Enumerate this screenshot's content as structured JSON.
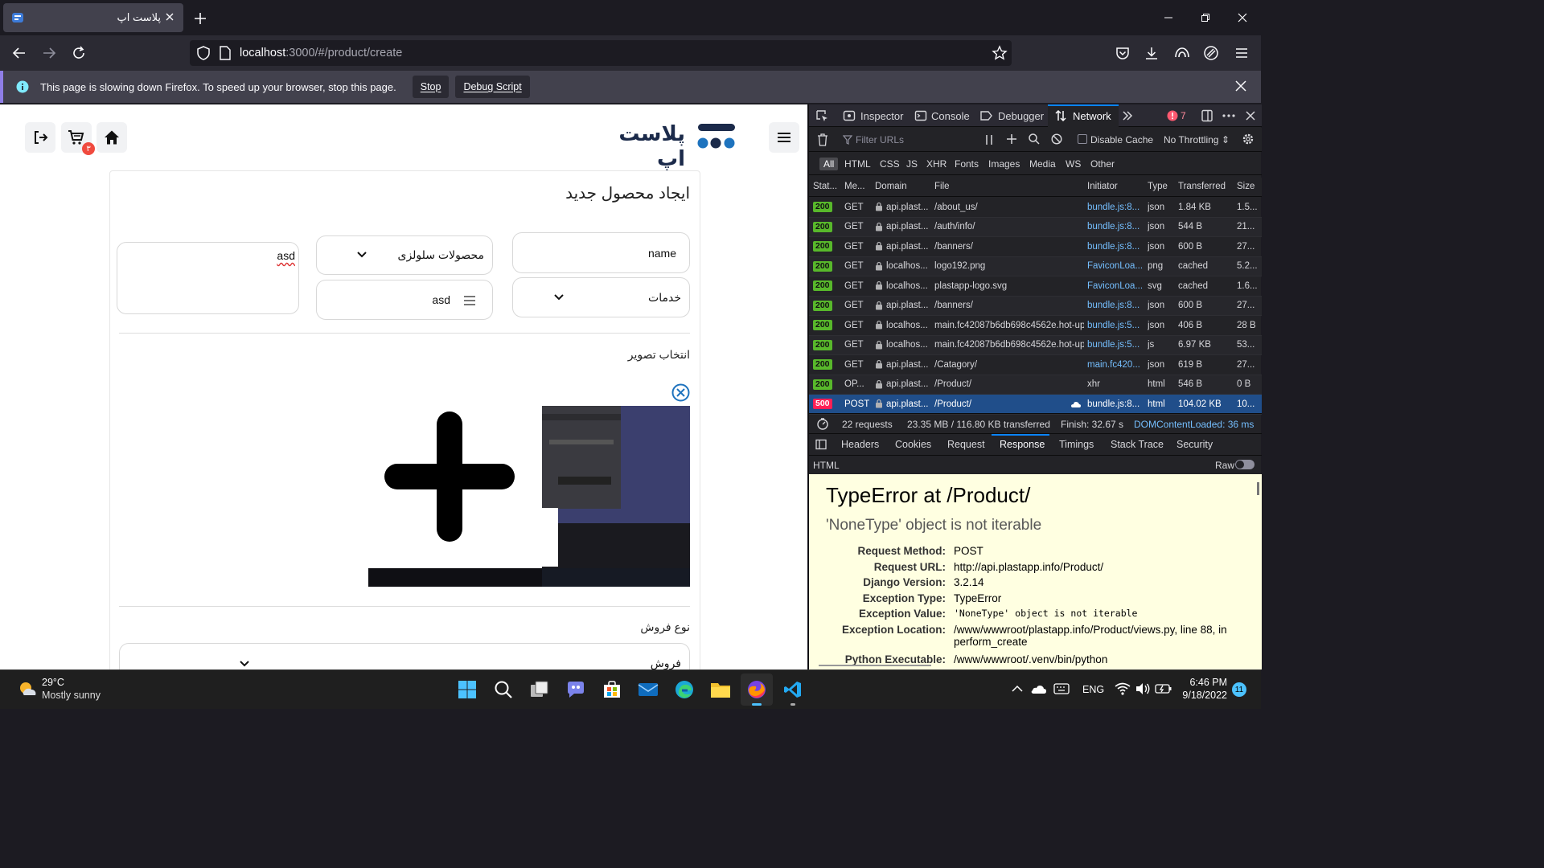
{
  "browser": {
    "tab_title": "پلاست اپ",
    "url_host": "localhost",
    "url_path": ":3000/#/product/create",
    "notification": {
      "message": "This page is slowing down Firefox. To speed up your browser, stop this page.",
      "stop_label": "Stop",
      "debug_label": "Debug Script"
    }
  },
  "app": {
    "brand_name": "پلاست اپ",
    "cart_count": "۳",
    "form_title": "ایجاد محصول جدید",
    "name_value": "name",
    "category_value": "محصولات سلولزی",
    "description_value": "asd",
    "service_value": "خدمات",
    "tag_value": "asd",
    "image_label": "انتخاب تصویر",
    "sale_type_label": "نوع فروش",
    "sale_type_value": "فروش"
  },
  "devtools": {
    "tabs": [
      "Inspector",
      "Console",
      "Debugger",
      "Network"
    ],
    "active_tab": "Network",
    "error_count": "7",
    "filter_placeholder": "Filter URLs",
    "disable_cache_label": "Disable Cache",
    "throttling_label": "No Throttling ⇕",
    "type_filters": [
      "All",
      "HTML",
      "CSS",
      "JS",
      "XHR",
      "Fonts",
      "Images",
      "Media",
      "WS",
      "Other"
    ],
    "columns": [
      "Stat...",
      "Me...",
      "Domain",
      "File",
      "Initiator",
      "Type",
      "Transferred",
      "Size"
    ],
    "requests": [
      {
        "status": "200",
        "method": "GET",
        "domain": "api.plast...",
        "file": "/about_us/",
        "initiator": "bundle.js:8...",
        "type": "json",
        "transferred": "1.84 KB",
        "size": "1.5..."
      },
      {
        "status": "200",
        "method": "GET",
        "domain": "api.plast...",
        "file": "/auth/info/",
        "initiator": "bundle.js:8...",
        "type": "json",
        "transferred": "544 B",
        "size": "21..."
      },
      {
        "status": "200",
        "method": "GET",
        "domain": "api.plast...",
        "file": "/banners/",
        "initiator": "bundle.js:8...",
        "type": "json",
        "transferred": "600 B",
        "size": "27..."
      },
      {
        "status": "200",
        "method": "GET",
        "domain": "localhos...",
        "file": "logo192.png",
        "initiator": "FaviconLoa...",
        "type": "png",
        "transferred": "cached",
        "size": "5.2..."
      },
      {
        "status": "200",
        "method": "GET",
        "domain": "localhos...",
        "file": "plastapp-logo.svg",
        "initiator": "FaviconLoa...",
        "type": "svg",
        "transferred": "cached",
        "size": "1.6..."
      },
      {
        "status": "200",
        "method": "GET",
        "domain": "api.plast...",
        "file": "/banners/",
        "initiator": "bundle.js:8...",
        "type": "json",
        "transferred": "600 B",
        "size": "27..."
      },
      {
        "status": "200",
        "method": "GET",
        "domain": "localhos...",
        "file": "main.fc42087b6db698c4562e.hot-up",
        "initiator": "bundle.js:5...",
        "type": "json",
        "transferred": "406 B",
        "size": "28 B"
      },
      {
        "status": "200",
        "method": "GET",
        "domain": "localhos...",
        "file": "main.fc42087b6db698c4562e.hot-up",
        "initiator": "bundle.js:5...",
        "type": "js",
        "transferred": "6.97 KB",
        "size": "53..."
      },
      {
        "status": "200",
        "method": "GET",
        "domain": "api.plast...",
        "file": "/Catagory/",
        "initiator": "main.fc420...",
        "type": "json",
        "transferred": "619 B",
        "size": "27..."
      },
      {
        "status": "200",
        "method": "OP...",
        "domain": "api.plast...",
        "file": "/Product/",
        "initiator": "xhr",
        "type": "html",
        "transferred": "546 B",
        "size": "0 B"
      },
      {
        "status": "500",
        "method": "POST",
        "domain": "api.plast...",
        "file": "/Product/",
        "initiator": "bundle.js:8...",
        "type": "html",
        "transferred": "104.02 KB",
        "size": "10..."
      }
    ],
    "summary": {
      "requests": "22 requests",
      "transferred": "23.35 MB / 116.80 KB transferred",
      "finish": "Finish: 32.67 s",
      "dcl": "DOMContentLoaded: 36 ms"
    },
    "detail_tabs": [
      "Headers",
      "Cookies",
      "Request",
      "Response",
      "Timings",
      "Stack Trace",
      "Security"
    ],
    "active_detail_tab": "Response",
    "response_format": "HTML",
    "raw_label": "Raw",
    "error": {
      "title": "TypeError at /Product/",
      "subtitle": "'NoneType' object is not iterable",
      "fields": [
        {
          "key": "Request Method:",
          "value": "POST"
        },
        {
          "key": "Request URL:",
          "value": "http://api.plastapp.info/Product/"
        },
        {
          "key": "Django Version:",
          "value": "3.2.14"
        },
        {
          "key": "Exception Type:",
          "value": "TypeError"
        },
        {
          "key": "Exception Value:",
          "value": "'NoneType' object is not iterable"
        },
        {
          "key": "Exception Location:",
          "value": "/www/wwwroot/plastapp.info/Product/views.py, line 88, in perform_create"
        },
        {
          "key": "Python Executable:",
          "value": "/www/wwwroot/.venv/bin/python"
        }
      ]
    }
  },
  "taskbar": {
    "temperature": "29°C",
    "weather": "Mostly sunny",
    "language": "ENG",
    "time": "6:46 PM",
    "date": "9/18/2022",
    "notifications": "11"
  },
  "colors": {
    "status_ok": "#58b82b",
    "status_error": "#ff2056",
    "selected_row": "#204e8a",
    "brand_blue": "#1e73be",
    "error_pane_bg": "#ffffe1"
  }
}
